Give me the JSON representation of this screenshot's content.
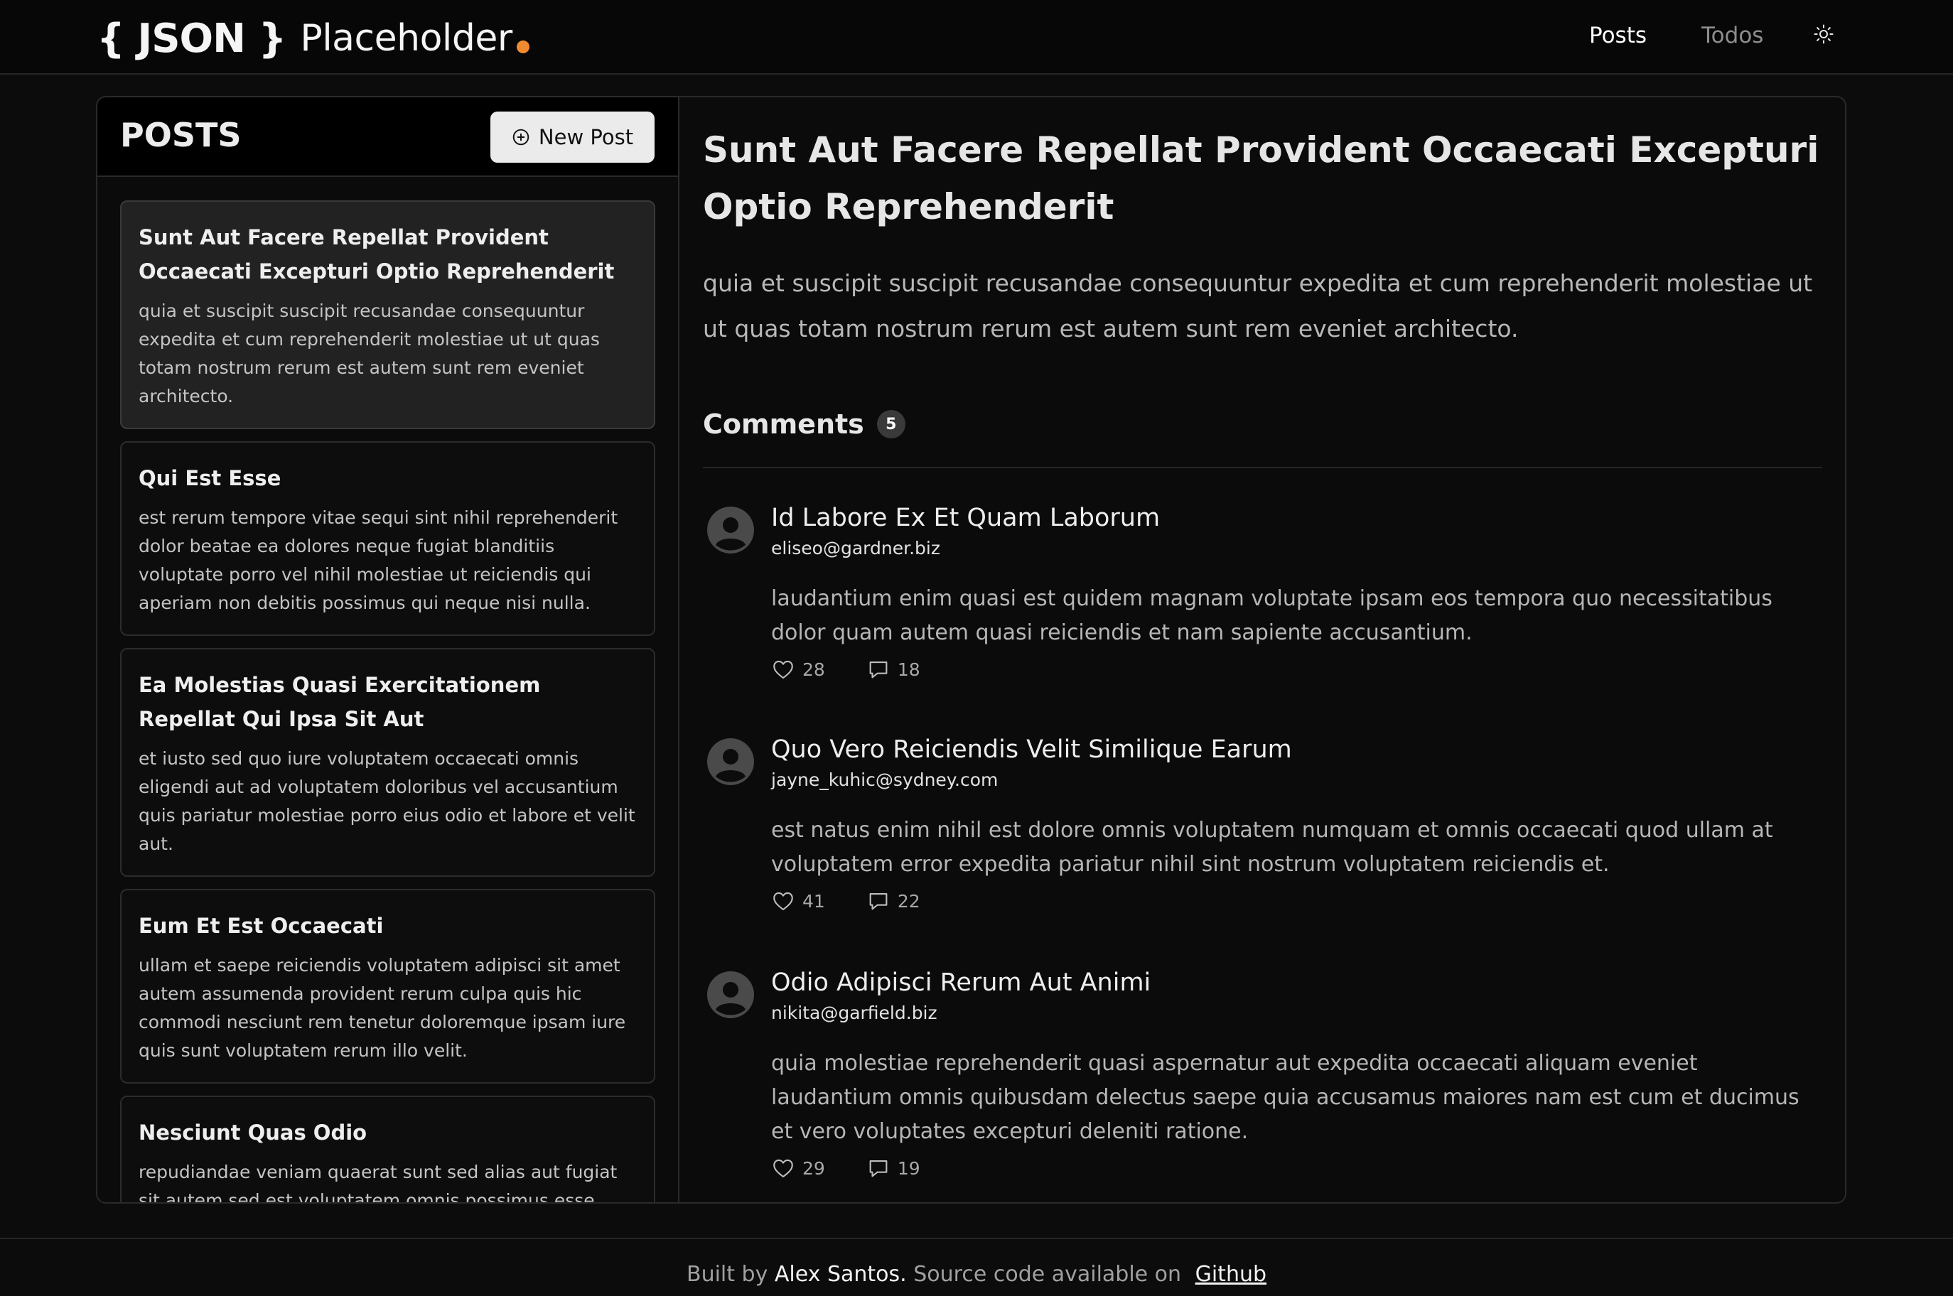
{
  "header": {
    "logo": {
      "braces": "{ JSON }",
      "word": "Placeholder"
    },
    "nav": [
      {
        "label": "Posts"
      },
      {
        "label": "Todos"
      }
    ],
    "theme_icon": "sun-icon"
  },
  "sidebar": {
    "heading": "POSTS",
    "new_post_label": "New Post",
    "posts": [
      {
        "title": "Sunt Aut Facere Repellat Provident Occaecati Excepturi Optio Reprehenderit",
        "body": "quia et suscipit suscipit recusandae consequuntur expedita et cum reprehenderit molestiae ut ut quas totam nostrum rerum est autem sunt rem eveniet architecto."
      },
      {
        "title": "Qui Est Esse",
        "body": "est rerum tempore vitae sequi sint nihil reprehenderit dolor beatae ea dolores neque fugiat blanditiis voluptate porro vel nihil molestiae ut reiciendis qui aperiam non debitis possimus qui neque nisi nulla."
      },
      {
        "title": "Ea Molestias Quasi Exercitationem Repellat Qui Ipsa Sit Aut",
        "body": "et iusto sed quo iure voluptatem occaecati omnis eligendi aut ad voluptatem doloribus vel accusantium quis pariatur molestiae porro eius odio et labore et velit aut."
      },
      {
        "title": "Eum Et Est Occaecati",
        "body": "ullam et saepe reiciendis voluptatem adipisci sit amet autem assumenda provident rerum culpa quis hic commodi nesciunt rem tenetur doloremque ipsam iure quis sunt voluptatem rerum illo velit."
      },
      {
        "title": "Nesciunt Quas Odio",
        "body": "repudiandae veniam quaerat sunt sed alias aut fugiat sit autem sed est voluptatem omnis possimus esse voluptatibus quis est aut tenetur dolor neque."
      }
    ]
  },
  "detail": {
    "title": "Sunt Aut Facere Repellat Provident Occaecati Excepturi Optio Reprehenderit",
    "body": "quia et suscipit suscipit recusandae consequuntur expedita et cum reprehenderit molestiae ut ut quas totam nostrum rerum est autem sunt rem eveniet architecto.",
    "comments_label": "Comments",
    "comments_count": "5",
    "comments": [
      {
        "name": "Id Labore Ex Et Quam Laborum",
        "email": "eliseo@gardner.biz",
        "body": "laudantium enim quasi est quidem magnam voluptate ipsam eos tempora quo necessitatibus dolor quam autem quasi reiciendis et nam sapiente accusantium.",
        "likes": "28",
        "replies": "18"
      },
      {
        "name": "Quo Vero Reiciendis Velit Similique Earum",
        "email": "jayne_kuhic@sydney.com",
        "body": "est natus enim nihil est dolore omnis voluptatem numquam et omnis occaecati quod ullam at voluptatem error expedita pariatur nihil sint nostrum voluptatem reiciendis et.",
        "likes": "41",
        "replies": "22"
      },
      {
        "name": "Odio Adipisci Rerum Aut Animi",
        "email": "nikita@garfield.biz",
        "body": "quia molestiae reprehenderit quasi aspernatur aut expedita occaecati aliquam eveniet laudantium omnis quibusdam delectus saepe quia accusamus maiores nam est cum et ducimus et vero voluptates excepturi deleniti ratione.",
        "likes": "29",
        "replies": "19"
      }
    ]
  },
  "footer": {
    "prefix": "Built by",
    "author": "Alex Santos.",
    "middle": "Source code available on",
    "link": "Github"
  },
  "colors": {
    "background": "#0c0c0c",
    "accent_dot": "#f08a30",
    "active_card": "#222222",
    "button_bg": "#ebebeb"
  }
}
